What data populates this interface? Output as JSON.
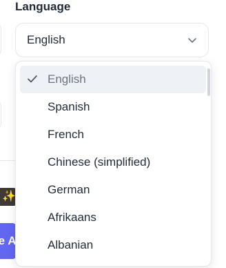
{
  "background": {
    "button_text": "te A",
    "emoji": "✨"
  },
  "language": {
    "label": "Language",
    "selected": "English",
    "options": [
      "English",
      "Spanish",
      "French",
      "Chinese (simplified)",
      "German",
      "Afrikaans",
      "Albanian"
    ]
  },
  "colors": {
    "accent": "#6366f1",
    "selected_bg": "#eef1f5",
    "border": "#e5e7eb"
  }
}
